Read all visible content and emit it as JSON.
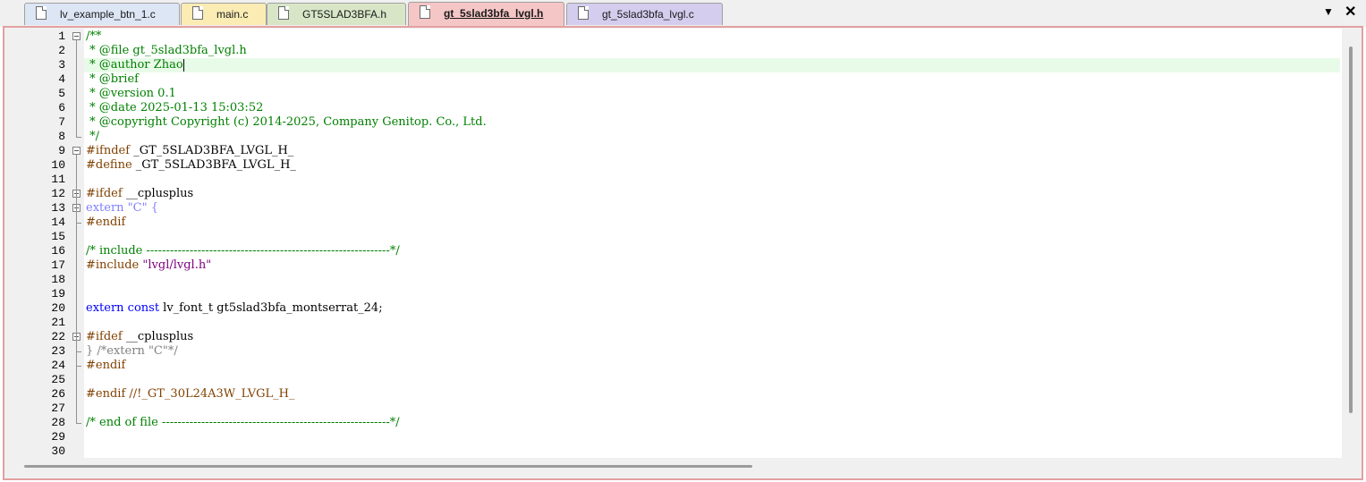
{
  "tabs": [
    {
      "label": "lv_example_btn_1.c",
      "color": "#dde6f5",
      "active": false
    },
    {
      "label": "main.c",
      "color": "#fbecb4",
      "active": false
    },
    {
      "label": "GT5SLAD3BFA.h",
      "color": "#d8e6c7",
      "active": false
    },
    {
      "label": "gt_5slad3bfa_lvgl.h",
      "color": "#f5c6c6",
      "active": true
    },
    {
      "label": "gt_5slad3bfa_lvgl.c",
      "color": "#d4cdee",
      "active": false
    }
  ],
  "window_controls": {
    "menu_arrow": "▼",
    "close": "✕"
  },
  "editor": {
    "current_line": 3,
    "lines": [
      {
        "n": "1",
        "text": "/**"
      },
      {
        "n": "2",
        "text": " * @file gt_5slad3bfa_lvgl.h"
      },
      {
        "n": "3",
        "text": " * @author Zhao"
      },
      {
        "n": "4",
        "text": " * @brief"
      },
      {
        "n": "5",
        "text": " * @version 0.1"
      },
      {
        "n": "6",
        "text": " * @date 2025-01-13 15:03:52"
      },
      {
        "n": "7",
        "text": " * @copyright Copyright (c) 2014-2025, Company Genitop. Co., Ltd."
      },
      {
        "n": "8",
        "text": " */"
      },
      {
        "n": "9",
        "text": "#ifndef _GT_5SLAD3BFA_LVGL_H_"
      },
      {
        "n": "10",
        "text": "#define _GT_5SLAD3BFA_LVGL_H_"
      },
      {
        "n": "11",
        "text": ""
      },
      {
        "n": "12",
        "text": "#ifdef __cplusplus"
      },
      {
        "n": "13",
        "text": "extern \"C\" {"
      },
      {
        "n": "14",
        "text": "#endif"
      },
      {
        "n": "15",
        "text": ""
      },
      {
        "n": "16",
        "text": "/* include --------------------------------------------------------------*/"
      },
      {
        "n": "17",
        "text": "#include \"lvgl/lvgl.h\""
      },
      {
        "n": "18",
        "text": ""
      },
      {
        "n": "19",
        "text": ""
      },
      {
        "n": "20",
        "text": "extern const lv_font_t gt5slad3bfa_montserrat_24;"
      },
      {
        "n": "21",
        "text": ""
      },
      {
        "n": "22",
        "text": "#ifdef __cplusplus"
      },
      {
        "n": "23",
        "text": "} /*extern \"C\"*/"
      },
      {
        "n": "24",
        "text": "#endif"
      },
      {
        "n": "25",
        "text": ""
      },
      {
        "n": "26",
        "text": "#endif //!_GT_30L24A3W_LVGL_H_"
      },
      {
        "n": "27",
        "text": ""
      },
      {
        "n": "28",
        "text": "/* end of file ----------------------------------------------------------*/"
      },
      {
        "n": "29",
        "text": ""
      },
      {
        "n": "30",
        "text": ""
      }
    ]
  }
}
